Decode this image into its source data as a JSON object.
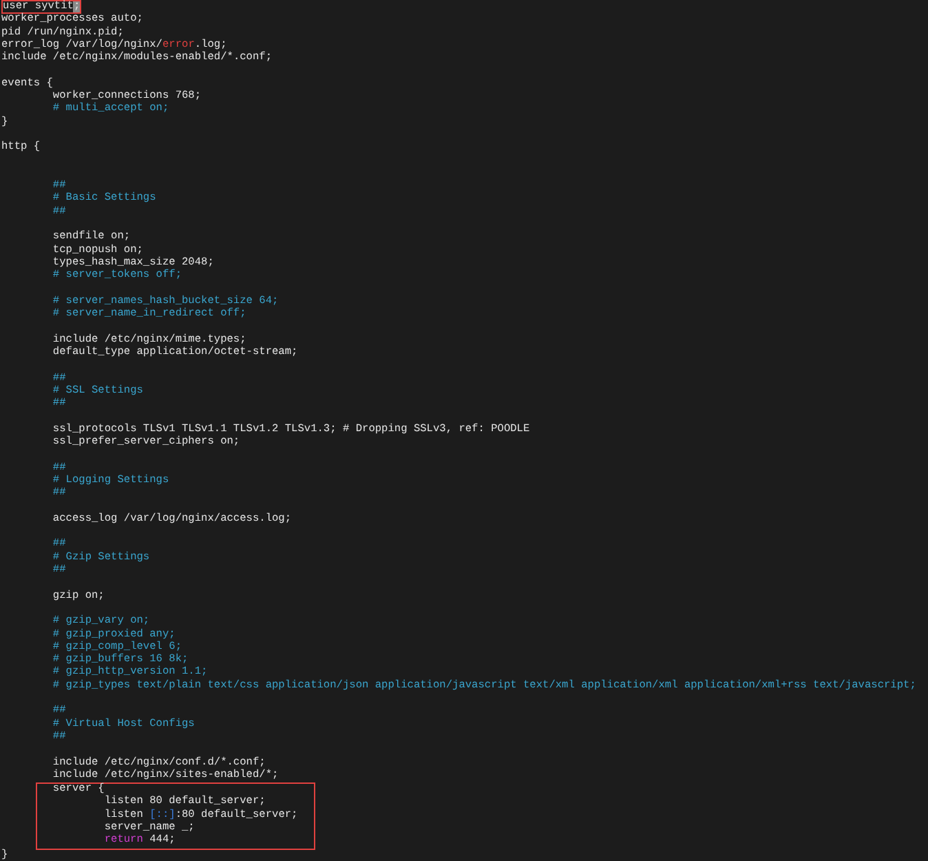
{
  "lines": [
    {
      "kind": "code",
      "highlighted": true,
      "segments": [
        {
          "text": "user syvtit",
          "kind": "plain"
        },
        {
          "text": ";",
          "kind": "cursor"
        }
      ]
    },
    {
      "kind": "code",
      "segments": [
        {
          "text": "worker_processes auto;",
          "kind": "plain"
        }
      ]
    },
    {
      "kind": "code",
      "segments": [
        {
          "text": "pid /run/nginx.pid;",
          "kind": "plain"
        }
      ]
    },
    {
      "kind": "code",
      "segments": [
        {
          "text": "error_log /var/log/nginx/",
          "kind": "plain"
        },
        {
          "text": "error",
          "kind": "error"
        },
        {
          "text": ".log;",
          "kind": "plain"
        }
      ]
    },
    {
      "kind": "code",
      "segments": [
        {
          "text": "include /etc/nginx/modules-enabled/*.conf;",
          "kind": "plain"
        }
      ]
    },
    {
      "kind": "blank"
    },
    {
      "kind": "code",
      "segments": [
        {
          "text": "events {",
          "kind": "plain"
        }
      ],
      "children": [
        {
          "kind": "code",
          "segments": [
            {
              "text": "worker_connections 768;",
              "kind": "plain"
            }
          ]
        },
        {
          "kind": "code",
          "segments": [
            {
              "text": "# multi_accept on;",
              "kind": "comment"
            }
          ]
        }
      ]
    },
    {
      "kind": "code",
      "segments": [
        {
          "text": "}",
          "kind": "plain"
        }
      ]
    },
    {
      "kind": "blank"
    },
    {
      "kind": "code",
      "segments": [
        {
          "text": "http {",
          "kind": "plain"
        }
      ],
      "children": [
        {
          "kind": "blank"
        },
        {
          "kind": "blank"
        },
        {
          "kind": "code",
          "segments": [
            {
              "text": "##",
              "kind": "comment"
            }
          ]
        },
        {
          "kind": "code",
          "segments": [
            {
              "text": "# Basic Settings",
              "kind": "comment"
            }
          ]
        },
        {
          "kind": "code",
          "segments": [
            {
              "text": "##",
              "kind": "comment"
            }
          ]
        },
        {
          "kind": "blank"
        },
        {
          "kind": "code",
          "segments": [
            {
              "text": "sendfile on;",
              "kind": "plain"
            }
          ]
        },
        {
          "kind": "code",
          "segments": [
            {
              "text": "tcp_nopush on;",
              "kind": "plain"
            }
          ]
        },
        {
          "kind": "code",
          "segments": [
            {
              "text": "types_hash_max_size 2048;",
              "kind": "plain"
            }
          ]
        },
        {
          "kind": "code",
          "segments": [
            {
              "text": "# server_tokens off;",
              "kind": "comment"
            }
          ]
        },
        {
          "kind": "blank"
        },
        {
          "kind": "code",
          "segments": [
            {
              "text": "# server_names_hash_bucket_size 64;",
              "kind": "comment"
            }
          ]
        },
        {
          "kind": "code",
          "segments": [
            {
              "text": "# server_name_in_redirect off;",
              "kind": "comment"
            }
          ]
        },
        {
          "kind": "blank"
        },
        {
          "kind": "code",
          "segments": [
            {
              "text": "include /etc/nginx/mime.types;",
              "kind": "plain"
            }
          ]
        },
        {
          "kind": "code",
          "segments": [
            {
              "text": "default_type application/octet-stream;",
              "kind": "plain"
            }
          ]
        },
        {
          "kind": "blank"
        },
        {
          "kind": "code",
          "segments": [
            {
              "text": "##",
              "kind": "comment"
            }
          ]
        },
        {
          "kind": "code",
          "segments": [
            {
              "text": "# SSL Settings",
              "kind": "comment"
            }
          ]
        },
        {
          "kind": "code",
          "segments": [
            {
              "text": "##",
              "kind": "comment"
            }
          ]
        },
        {
          "kind": "blank"
        },
        {
          "kind": "code",
          "segments": [
            {
              "text": "ssl_protocols TLSv1 TLSv1.1 TLSv1.2 TLSv1.3; # Dropping SSLv3, ref: POODLE",
              "kind": "plain"
            }
          ]
        },
        {
          "kind": "code",
          "segments": [
            {
              "text": "ssl_prefer_server_ciphers on;",
              "kind": "plain"
            }
          ]
        },
        {
          "kind": "blank"
        },
        {
          "kind": "code",
          "segments": [
            {
              "text": "##",
              "kind": "comment"
            }
          ]
        },
        {
          "kind": "code",
          "segments": [
            {
              "text": "# Logging Settings",
              "kind": "comment"
            }
          ]
        },
        {
          "kind": "code",
          "segments": [
            {
              "text": "##",
              "kind": "comment"
            }
          ]
        },
        {
          "kind": "blank"
        },
        {
          "kind": "code",
          "segments": [
            {
              "text": "access_log /var/log/nginx/access.log;",
              "kind": "plain"
            }
          ]
        },
        {
          "kind": "blank"
        },
        {
          "kind": "code",
          "segments": [
            {
              "text": "##",
              "kind": "comment"
            }
          ]
        },
        {
          "kind": "code",
          "segments": [
            {
              "text": "# Gzip Settings",
              "kind": "comment"
            }
          ]
        },
        {
          "kind": "code",
          "segments": [
            {
              "text": "##",
              "kind": "comment"
            }
          ]
        },
        {
          "kind": "blank"
        },
        {
          "kind": "code",
          "segments": [
            {
              "text": "gzip on;",
              "kind": "plain"
            }
          ]
        },
        {
          "kind": "blank"
        },
        {
          "kind": "code",
          "segments": [
            {
              "text": "# gzip_vary on;",
              "kind": "comment"
            }
          ]
        },
        {
          "kind": "code",
          "segments": [
            {
              "text": "# gzip_proxied any;",
              "kind": "comment"
            }
          ]
        },
        {
          "kind": "code",
          "segments": [
            {
              "text": "# gzip_comp_level 6;",
              "kind": "comment"
            }
          ]
        },
        {
          "kind": "code",
          "segments": [
            {
              "text": "# gzip_buffers 16 8k;",
              "kind": "comment"
            }
          ]
        },
        {
          "kind": "code",
          "segments": [
            {
              "text": "# gzip_http_version 1.1;",
              "kind": "comment"
            }
          ]
        },
        {
          "kind": "code",
          "segments": [
            {
              "text": "# gzip_types text/plain text/css application/json application/javascript text/xml application/xml application/xml+rss text/javascript;",
              "kind": "comment"
            }
          ]
        },
        {
          "kind": "blank"
        },
        {
          "kind": "code",
          "segments": [
            {
              "text": "##",
              "kind": "comment"
            }
          ]
        },
        {
          "kind": "code",
          "segments": [
            {
              "text": "# Virtual Host Configs",
              "kind": "comment"
            }
          ]
        },
        {
          "kind": "code",
          "segments": [
            {
              "text": "##",
              "kind": "comment"
            }
          ]
        },
        {
          "kind": "blank"
        },
        {
          "kind": "code",
          "segments": [
            {
              "text": "include /etc/nginx/conf.d/*.conf;",
              "kind": "plain"
            }
          ]
        },
        {
          "kind": "code",
          "segments": [
            {
              "text": "include /etc/nginx/sites-enabled/*;",
              "kind": "plain"
            }
          ]
        },
        {
          "kind": "code",
          "highlighted": true,
          "segments": [
            {
              "text": "server {",
              "kind": "plain"
            }
          ],
          "children": [
            {
              "kind": "code",
              "segments": [
                {
                  "text": "listen 80 default_server;",
                  "kind": "plain"
                }
              ]
            },
            {
              "kind": "code",
              "segments": [
                {
                  "text": "listen ",
                  "kind": "plain"
                },
                {
                  "text": "[::]",
                  "kind": "bracket"
                },
                {
                  "text": ":80 default_server;",
                  "kind": "plain"
                }
              ]
            },
            {
              "kind": "code",
              "segments": [
                {
                  "text": "server_name _;",
                  "kind": "plain"
                }
              ]
            },
            {
              "kind": "code",
              "segments": [
                {
                  "text": "return",
                  "kind": "keyword"
                },
                {
                  "text": " 444;",
                  "kind": "plain"
                }
              ]
            }
          ]
        }
      ]
    },
    {
      "kind": "code",
      "segments": [
        {
          "text": "}",
          "kind": "plain"
        }
      ]
    }
  ]
}
